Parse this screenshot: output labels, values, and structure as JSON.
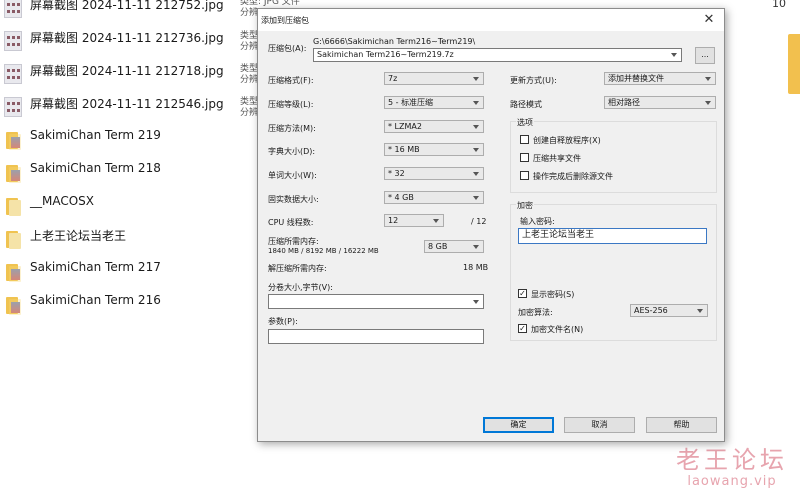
{
  "explorer": {
    "top_right_count": "10",
    "meta_type_label": "类型: JPG 文件",
    "meta_type_short": "类型",
    "meta_size_short": "分辨",
    "files": [
      {
        "name": "屏幕截图 2024-11-11 212752.jpg",
        "kind": "image",
        "icon": "image-thumbnail-icon"
      },
      {
        "name": "屏幕截图 2024-11-11 212736.jpg",
        "kind": "image",
        "icon": "image-thumbnail-icon"
      },
      {
        "name": "屏幕截图 2024-11-11 212718.jpg",
        "kind": "image",
        "icon": "image-thumbnail-icon"
      },
      {
        "name": "屏幕截图 2024-11-11 212546.jpg",
        "kind": "image",
        "icon": "image-thumbnail-icon"
      },
      {
        "name": "SakimiChan Term 219",
        "kind": "folder-photo",
        "icon": "folder-icon"
      },
      {
        "name": "SakimiChan Term 218",
        "kind": "folder-photo",
        "icon": "folder-icon"
      },
      {
        "name": "__MACOSX",
        "kind": "folder",
        "icon": "folder-icon"
      },
      {
        "name": "上老王论坛当老王",
        "kind": "folder",
        "icon": "folder-icon"
      },
      {
        "name": "SakimiChan Term 217",
        "kind": "folder-photo",
        "icon": "folder-icon"
      },
      {
        "name": "SakimiChan Term 216",
        "kind": "folder-photo",
        "icon": "folder-icon"
      }
    ]
  },
  "watermark": {
    "text": "老王论坛",
    "url": "laowang.vip"
  },
  "dialog": {
    "title": "添加到压缩包",
    "close": "✕",
    "archive_label": "压缩包(A):",
    "archive_path": "G:\\6666\\Sakimichan Term216~Term219\\",
    "archive_name": "Sakimichan Term216~Term219.7z",
    "browse_label": "...",
    "format_label": "压缩格式(F):",
    "format_value": "7z",
    "level_label": "压缩等级(L):",
    "level_value": "5 - 标准压缩",
    "method_label": "压缩方法(M):",
    "method_value": "* LZMA2",
    "dict_label": "字典大小(D):",
    "dict_value": "* 16 MB",
    "word_label": "单词大小(W):",
    "word_value": "* 32",
    "solid_label": "固实数据大小:",
    "solid_value": "* 4 GB",
    "cpu_label": "CPU 线程数:",
    "cpu_value": "12",
    "cpu_total": "/ 12",
    "mem_comp_label": "压缩所需内存:",
    "mem_comp_detail": "1840 MB / 8192 MB / 16222 MB",
    "mem_comp_value": "8 GB",
    "mem_decomp_label": "解压缩所需内存:",
    "mem_decomp_value": "18 MB",
    "split_label": "分卷大小,字节(V):",
    "split_value": "",
    "params_label": "参数(P):",
    "params_value": "",
    "update_label": "更新方式(U):",
    "update_value": "添加并替换文件",
    "path_label": "路径模式",
    "path_value": "相对路径",
    "options_title": "选项",
    "opt_sfx": "创建自释放程序(X)",
    "opt_shared": "压缩共享文件",
    "opt_delete": "操作完成后删除源文件",
    "encrypt_title": "加密",
    "password_label": "输入密码:",
    "password_value": "上老王论坛当老王",
    "show_password": "显示密码(S)",
    "enc_method_label": "加密算法:",
    "enc_method_value": "AES-256",
    "enc_names": "加密文件名(N)",
    "checked_mark": "✓",
    "ok": "确定",
    "cancel": "取消",
    "help": "帮助"
  }
}
